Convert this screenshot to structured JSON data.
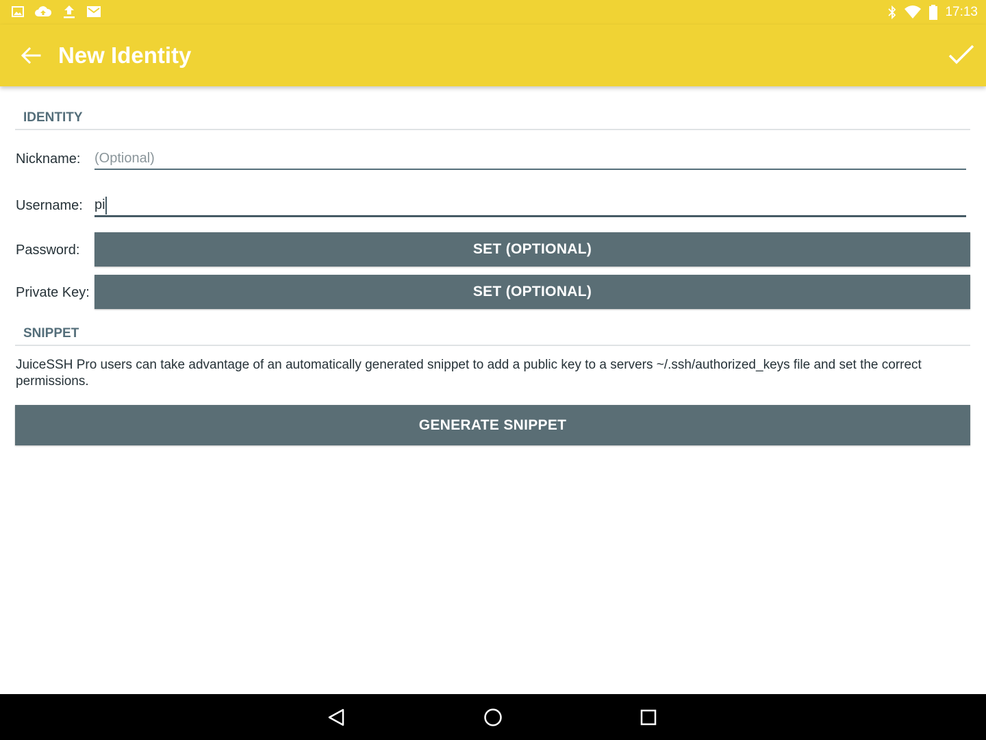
{
  "status_bar": {
    "time": "17:13",
    "left_icons": [
      "image-icon",
      "cloud-upload-icon",
      "upload-icon",
      "gmail-icon"
    ],
    "right_icons": [
      "bluetooth-icon",
      "wifi-icon",
      "battery-icon"
    ]
  },
  "toolbar": {
    "title": "New Identity",
    "accent_color": "#f0d334"
  },
  "identity_section": {
    "header": "IDENTITY",
    "nickname_label": "Nickname:",
    "nickname_value": "",
    "nickname_placeholder": "(Optional)",
    "username_label": "Username:",
    "username_value": "pi",
    "password_label": "Password:",
    "password_button": "SET (OPTIONAL)",
    "private_key_label": "Private Key:",
    "private_key_button": "SET (OPTIONAL)"
  },
  "snippet_section": {
    "header": "SNIPPET",
    "description": "JuiceSSH Pro users can take advantage of an automatically generated snippet to add a public key to a servers ~/.ssh/authorized_keys file and set the correct permissions.",
    "generate_button": "GENERATE SNIPPET",
    "button_color": "#5a6e75"
  },
  "nav_bar": {
    "buttons": [
      "back-nav-icon",
      "home-nav-icon",
      "recents-nav-icon"
    ]
  }
}
